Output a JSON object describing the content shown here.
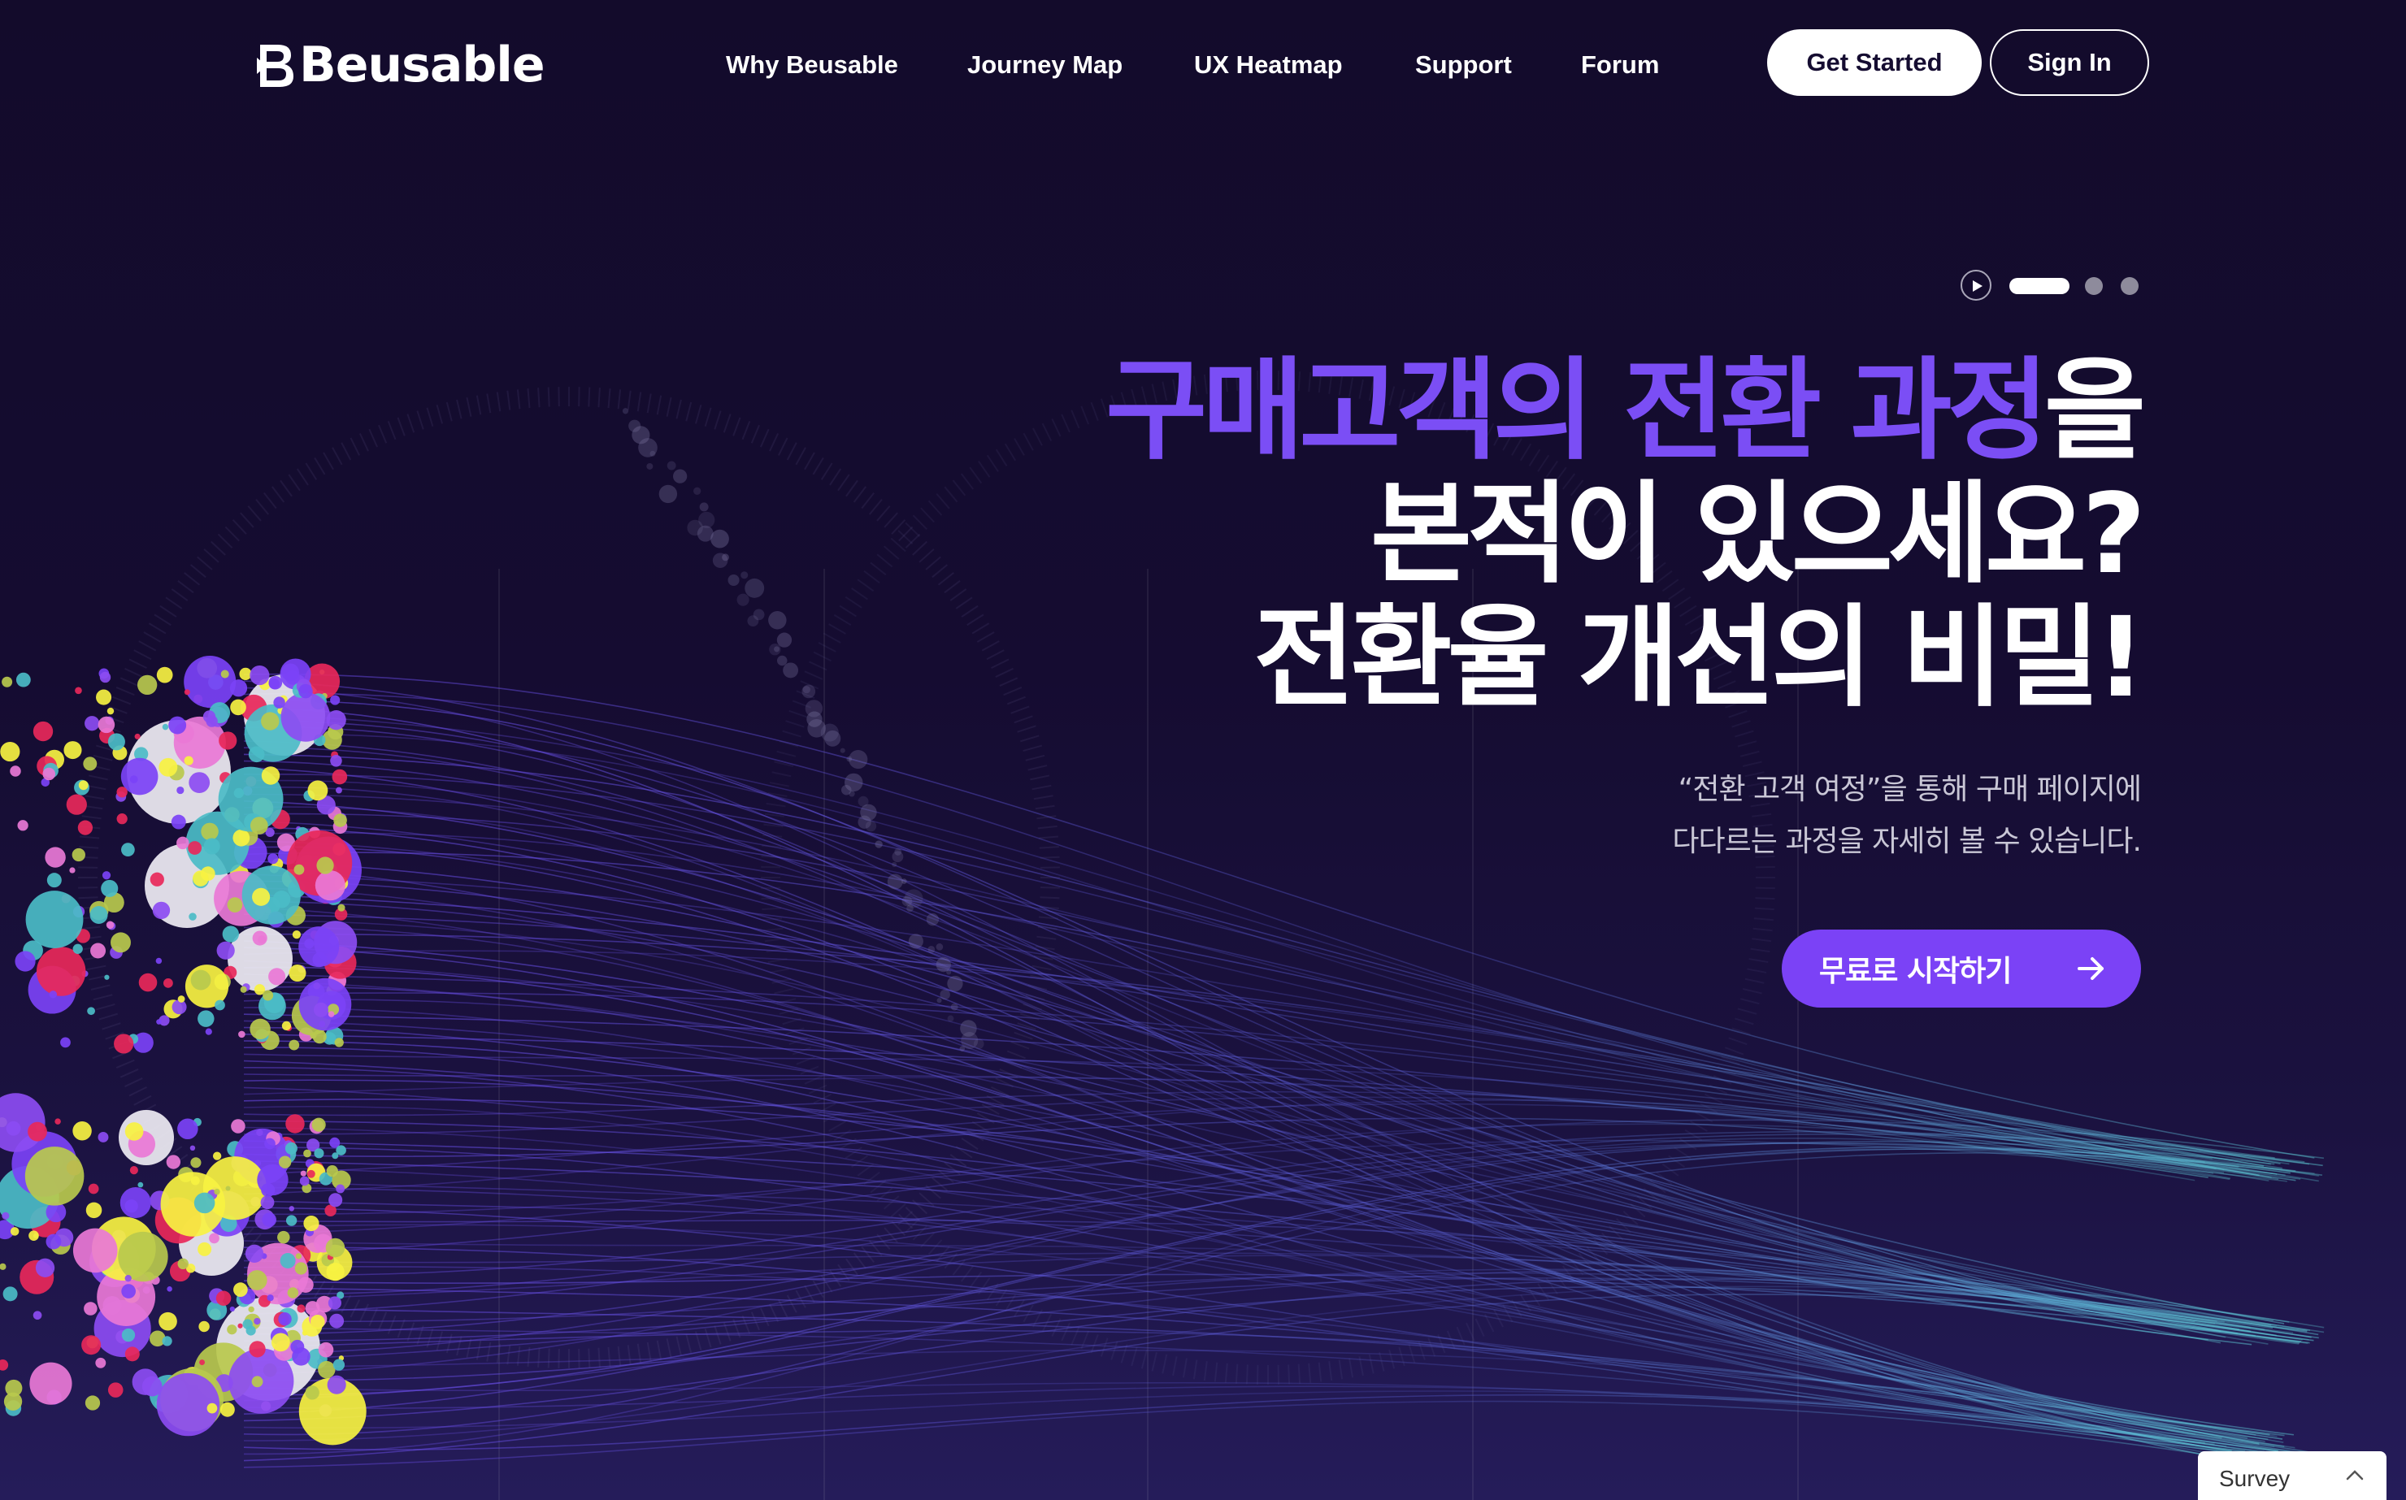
{
  "brand": {
    "name": "Beusable",
    "accent_color": "#7b4ef5",
    "cta_color": "#7b42f6",
    "background_color": "#150c31"
  },
  "nav": {
    "items": [
      {
        "label": "Why Beusable"
      },
      {
        "label": "Journey Map"
      },
      {
        "label": "UX Heatmap"
      },
      {
        "label": "Support"
      },
      {
        "label": "Forum"
      }
    ],
    "get_started_label": "Get Started",
    "sign_in_label": "Sign In"
  },
  "slider": {
    "play_icon": "play-icon",
    "slide_count": 3,
    "active_index": 0
  },
  "hero": {
    "title_line1_accent": "구매고객의 전환 과정",
    "title_line1_rest": "을",
    "title_line2": "본적이 있으세요?",
    "title_line3": "전환율 개선의 비밀!",
    "subtitle_line1": "“전환 고객 여정”을 통해 구매 페이지에",
    "subtitle_line2": "다다르는 과정을 자세히 볼 수 있습니다.",
    "cta_label": "무료로 시작하기",
    "cta_icon": "arrow-right-icon"
  },
  "survey": {
    "label": "Survey",
    "icon": "chevron-up-icon"
  }
}
